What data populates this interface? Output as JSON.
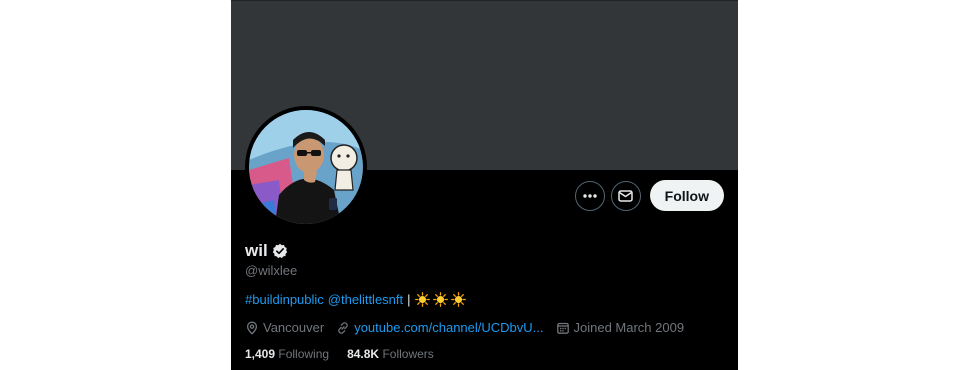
{
  "profile": {
    "display_name": "wil",
    "handle": "@wilxlee",
    "verified": true,
    "bio": {
      "tag1": "#buildinpublic",
      "tag2": "@thelittlesnft",
      "separator": "|",
      "emoji_count": 3
    },
    "location": "Vancouver",
    "website": "youtube.com/channel/UCDbvU...",
    "joined": "Joined March 2009",
    "following_count": "1,409",
    "following_label": "Following",
    "followers_count": "84.8K",
    "followers_label": "Followers"
  },
  "actions": {
    "more_icon": "more-icon",
    "message_icon": "envelope-icon",
    "follow_label": "Follow"
  },
  "colors": {
    "banner": "#333639",
    "background": "#000000",
    "link": "#1d9bf0",
    "muted": "#71767b",
    "text": "#e7e9ea",
    "verified_badge": "#e7e9ea"
  }
}
